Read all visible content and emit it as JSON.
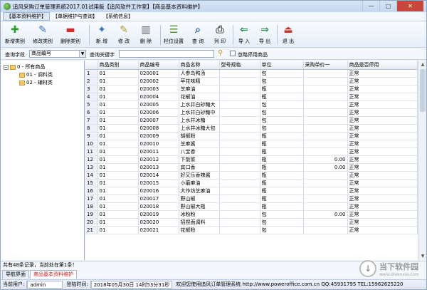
{
  "window": {
    "title": "追风采购订单管理系统2017.01试用版【追风软件工作室】【商品基本资料维护】",
    "buttons": {
      "minimize": "—",
      "maximize": "□",
      "close": "✕"
    }
  },
  "menu": [
    "【基本资料维护】",
    "【单据维护与查询】",
    "【系统信息】"
  ],
  "toolbar": [
    {
      "label": "新增类别",
      "icon": "plus-icon",
      "glyph": "✚",
      "color": "#2e9b2e"
    },
    {
      "label": "修改类别",
      "icon": "pencil-icon",
      "glyph": "✎",
      "color": "#3c6fb3"
    },
    {
      "label": "删除类别",
      "icon": "minus-icon",
      "glyph": "▬",
      "color": "#d22b2b"
    },
    {
      "label": "新 增",
      "icon": "new-doc-icon",
      "glyph": "✦",
      "color": "#3c6fb3"
    },
    {
      "label": "修 改",
      "icon": "edit-icon",
      "glyph": "✎",
      "color": "#b59a2c"
    },
    {
      "label": "删 除",
      "icon": "trash-icon",
      "glyph": "▥",
      "color": "#666666"
    },
    {
      "label": "栏位设置",
      "icon": "columns-icon",
      "glyph": "☰",
      "color": "#4d8a2b"
    },
    {
      "label": "查 询",
      "icon": "search-icon",
      "glyph": "⌕",
      "color": "#2f5f9f"
    },
    {
      "label": "列 印",
      "icon": "print-icon",
      "glyph": "⎙",
      "color": "#555555"
    },
    {
      "label": "导 入",
      "icon": "import-icon",
      "glyph": "⇐",
      "color": "#2e8b57"
    },
    {
      "label": "导 出",
      "icon": "export-icon",
      "glyph": "⇒",
      "color": "#2e8b57"
    },
    {
      "label": "退 出",
      "icon": "exit-icon",
      "glyph": "⏏",
      "color": "#c0392b"
    }
  ],
  "query": {
    "field_label": "查询字段",
    "field_value": "商品编号",
    "keyword_label": "查询关键字",
    "keyword_value": "",
    "checkbox_label": "忽略停用商品"
  },
  "tree": {
    "root": "0 - 所有商品",
    "children": [
      "01 - 调料类",
      "02 - 辅材类"
    ]
  },
  "table": {
    "columns": [
      "",
      "商品类别",
      "商品编号",
      "商品名称",
      "型号规格",
      "单位",
      "采购单价一",
      "商品是否停用"
    ],
    "rows": [
      [
        "1",
        "01",
        "020001",
        "人参鸟鸭汤",
        "",
        "包",
        "",
        "正常"
      ],
      [
        "2",
        "01",
        "020002",
        "苹花味精",
        "",
        "包",
        "",
        "正常"
      ],
      [
        "3",
        "01",
        "020003",
        "芝麻油",
        "",
        "瓶",
        "",
        "正常"
      ],
      [
        "4",
        "01",
        "020004",
        "花椒油",
        "",
        "瓶",
        "",
        "正常"
      ],
      [
        "5",
        "01",
        "020005",
        "上水井白砂糖大",
        "",
        "包",
        "",
        "正常"
      ],
      [
        "6",
        "01",
        "020006",
        "上水井白砂糖中",
        "",
        "包",
        "",
        "正常"
      ],
      [
        "7",
        "01",
        "020007",
        "上水井冰糖",
        "",
        "包",
        "",
        "正常"
      ],
      [
        "8",
        "01",
        "020008",
        "上水井冰糖大包",
        "",
        "包",
        "",
        "正常"
      ],
      [
        "9",
        "01",
        "020009",
        "胡椒粉",
        "",
        "瓶",
        "",
        "正常"
      ],
      [
        "10",
        "01",
        "020010",
        "芝麻酱",
        "",
        "瓶",
        "",
        "正常"
      ],
      [
        "11",
        "01",
        "020011",
        "八宝香",
        "",
        "瓶",
        "",
        "正常"
      ],
      [
        "12",
        "01",
        "020012",
        "下饭菜",
        "",
        "瓶",
        "0.00",
        "正常"
      ],
      [
        "13",
        "01",
        "020013",
        "宾口香",
        "",
        "瓶",
        "0.00",
        "正常"
      ],
      [
        "14",
        "01",
        "020014",
        "好又乐香辣酱",
        "",
        "瓶",
        "",
        "正常"
      ],
      [
        "15",
        "01",
        "020015",
        "小磨麻油",
        "",
        "瓶",
        "",
        "正常"
      ],
      [
        "16",
        "01",
        "020016",
        "大作坊芝麻油",
        "",
        "瓶",
        "",
        "正常"
      ],
      [
        "17",
        "01",
        "020017",
        "野山椒",
        "",
        "瓶",
        "",
        "正常"
      ],
      [
        "18",
        "01",
        "020018",
        "野山椒大瓶",
        "",
        "瓶",
        "",
        "正常"
      ],
      [
        "19",
        "01",
        "020019",
        "冰粉粉",
        "",
        "包",
        "0.00",
        "正常"
      ],
      [
        "20",
        "01",
        "020020",
        "招捏面调料",
        "",
        "包",
        "",
        "正常"
      ],
      [
        "21",
        "01",
        "020021",
        "花椒粉",
        "",
        "包",
        "",
        "正常"
      ]
    ]
  },
  "status_records": "共有48条记录，当前处在第1条！",
  "tabs": [
    "导航界面",
    "商品基本资料维护"
  ],
  "statusbar": {
    "user_label": "当前用户:",
    "user_value": "admin",
    "time_label": "登陆时间:",
    "time_value": "2018年05月30日 14时53分31秒",
    "welcome": "欢迎您使用追风订单管理系统 http://www.poweroffice.com.cn QQ:45931795 TEL:15962625220"
  },
  "watermark": {
    "logo": "↓",
    "cn": "当下软件园",
    "en": "www.downxia.com"
  }
}
